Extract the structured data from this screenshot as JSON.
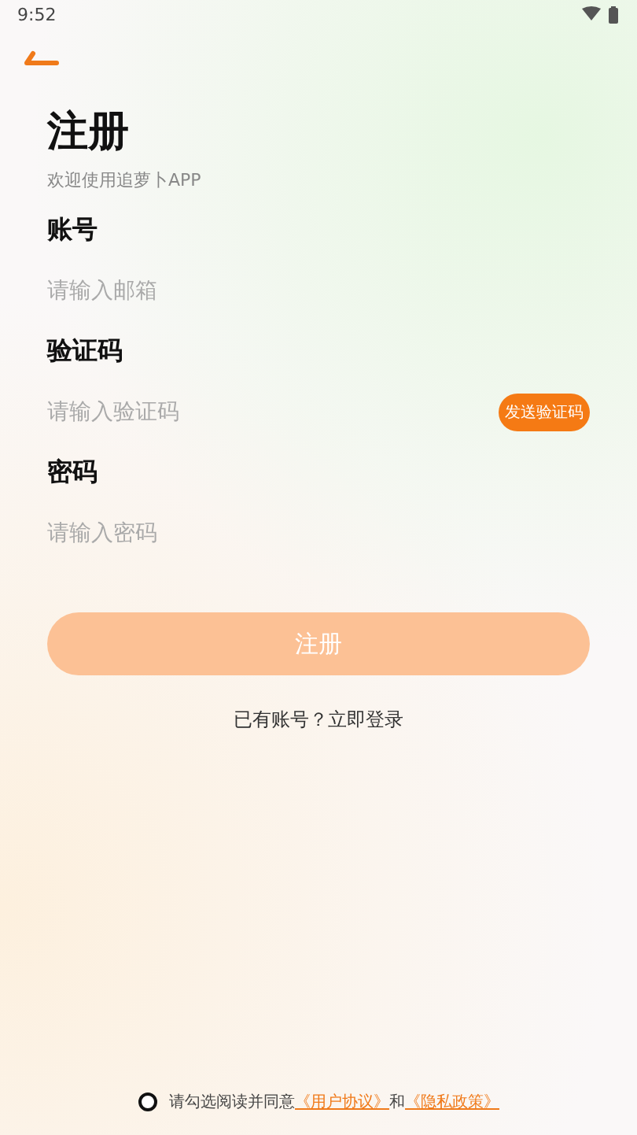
{
  "status_bar": {
    "time": "9:52"
  },
  "header": {
    "title": "注册",
    "subtitle": "欢迎使用追萝卜APP"
  },
  "fields": [
    {
      "label": "账号",
      "placeholder": "请输入邮箱",
      "kind": "text"
    },
    {
      "label": "验证码",
      "placeholder": "请输入验证码",
      "kind": "code",
      "action": "发送验证码"
    },
    {
      "label": "密码",
      "placeholder": "请输入密码",
      "kind": "password"
    }
  ],
  "submit": {
    "label": "注册",
    "disabled": true
  },
  "login_link": "已有账号？立即登录",
  "agreement": {
    "checked": false,
    "text": "请勾选阅读并同意",
    "links": [
      "《用户协议》",
      "《隐私政策》"
    ],
    "joiner": "和"
  }
}
